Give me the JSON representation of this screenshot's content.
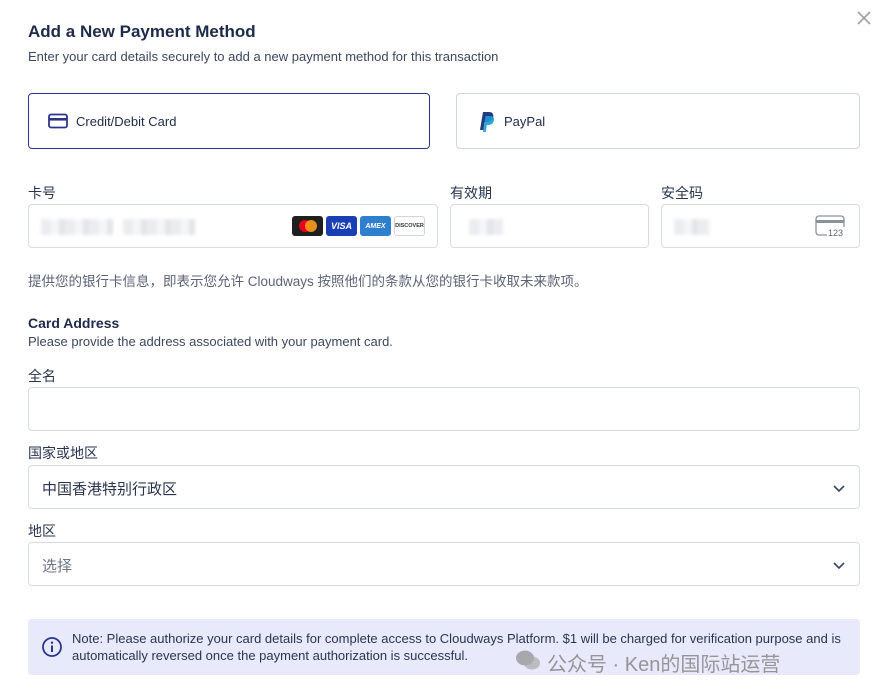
{
  "dialog": {
    "title": "Add a New Payment Method",
    "subtitle": "Enter your card details securely to add a new payment method for this transaction"
  },
  "methods": [
    {
      "label": "Credit/Debit Card",
      "icon": "credit-card-icon",
      "selected": true
    },
    {
      "label": "PayPal",
      "icon": "paypal-icon",
      "selected": false
    }
  ],
  "card": {
    "number_label": "卡号",
    "expiry_label": "有效期",
    "cvc_label": "安全码",
    "brands": [
      "mastercard",
      "VISA",
      "AMEX",
      "DISCOVER"
    ],
    "cvc_icon_text": "123"
  },
  "consent": "提供您的银行卡信息，即表示您允许 Cloudways 按照他们的条款从您的银行卡收取未来款项。",
  "address": {
    "title": "Card Address",
    "subtitle": "Please provide the address associated with your payment card.",
    "full_name_label": "全名",
    "full_name_value": "",
    "country_label": "国家或地区",
    "country_value": "中国香港特别行政区",
    "region_label": "地区",
    "region_value": "选择"
  },
  "note": {
    "text": "Note: Please authorize your card details for complete access to Cloudways Platform. $1 will be charged for verification purpose and is automatically reversed once the payment authorization is successful."
  },
  "watermark": {
    "text": "公众号 · Ken的国际站运营"
  },
  "colors": {
    "accent": "#2b3590",
    "note_bg": "#e8eafb",
    "border": "#d7dbe3"
  }
}
